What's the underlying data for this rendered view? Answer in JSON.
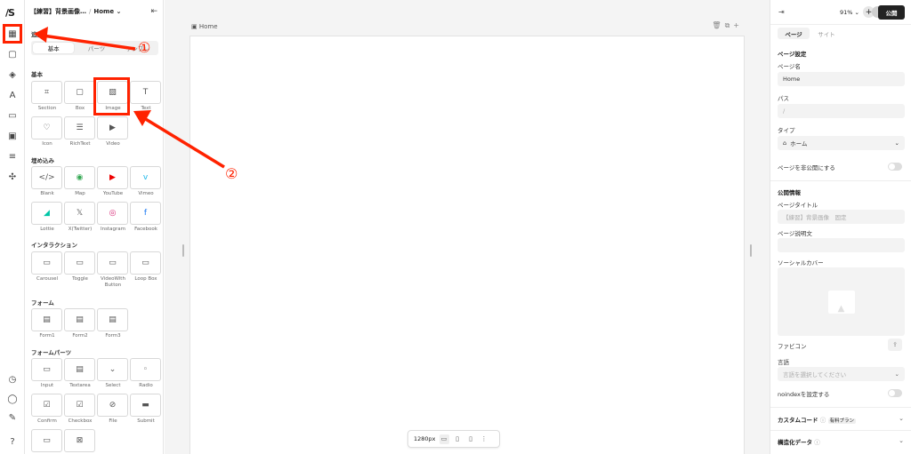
{
  "app": {
    "logo": "/S"
  },
  "panel": {
    "project_title": "【練習】背景画像…",
    "page_name": "Home",
    "add_label": "追加",
    "tabs": [
      "基本",
      "パーツ",
      "テンプレ"
    ],
    "sections": {
      "basic": {
        "title": "基本",
        "items": [
          "Section",
          "Box",
          "Image",
          "Text",
          "Icon",
          "RichText",
          "Video"
        ]
      },
      "embed": {
        "title": "埋め込み",
        "items": [
          "Blank",
          "Map",
          "YouTube",
          "Vimeo",
          "Lottie",
          "X(Twitter)",
          "Instagram",
          "Facebook"
        ]
      },
      "interaction": {
        "title": "インタラクション",
        "items": [
          "Carousel",
          "Toggle",
          "VideoWith Button",
          "Loop Box"
        ]
      },
      "form": {
        "title": "フォーム",
        "items": [
          "Form1",
          "Form2",
          "Form3"
        ]
      },
      "form_parts": {
        "title": "フォームパーツ",
        "items": [
          "Input",
          "Textarea",
          "Select",
          "Radio",
          "Confirm",
          "Checkbox",
          "File",
          "Submit"
        ]
      }
    }
  },
  "canvas": {
    "page_label": "Home",
    "width_label": "1280px"
  },
  "right": {
    "zoom": "91%",
    "publish_label": "公開",
    "tabs": [
      "ページ",
      "サイト"
    ],
    "page_settings": "ページ設定",
    "page_name_label": "ページ名",
    "page_name_value": "Home",
    "path_label": "パス",
    "path_value": "/",
    "type_label": "タイプ",
    "type_value": "ホーム",
    "hide_label": "ページを非公開にする",
    "public_info": "公開情報",
    "page_title_label": "ページタイトル",
    "page_title_placeholder": "【練習】背景画像　固定",
    "page_desc_label": "ページ説明文",
    "social_cover_label": "ソーシャルカバー",
    "favicon_label": "ファビコン",
    "lang_label": "言語",
    "lang_placeholder": "言語を選択してください",
    "noindex_label": "noindexを設定する",
    "custom_code_label": "カスタムコード",
    "paid_badge": "有料プラン",
    "structured_data_label": "構造化データ"
  },
  "annotations": {
    "one": "①",
    "two": "②"
  },
  "colors": {
    "annotation": "#ff2200",
    "publish": "#222222"
  }
}
